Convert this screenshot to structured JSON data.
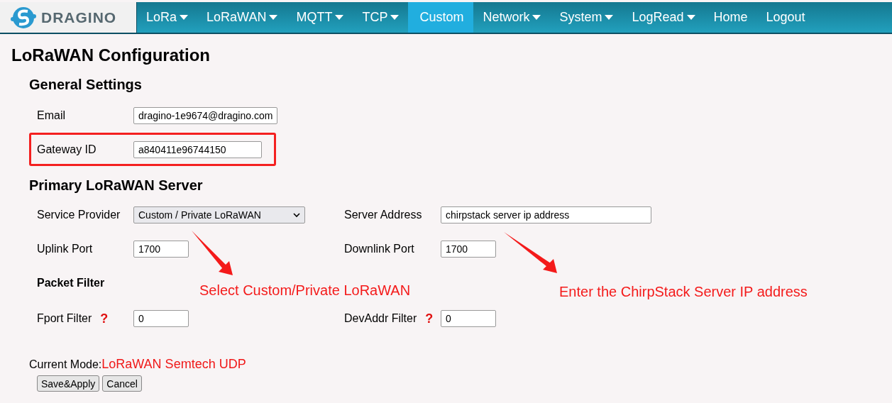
{
  "navbar": {
    "logo_text": "DRAGINO",
    "items": [
      {
        "label": "LoRa",
        "dropdown": true,
        "selected": false
      },
      {
        "label": "LoRaWAN",
        "dropdown": true,
        "selected": false
      },
      {
        "label": "MQTT",
        "dropdown": true,
        "selected": false
      },
      {
        "label": "TCP",
        "dropdown": true,
        "selected": false
      },
      {
        "label": "Custom",
        "dropdown": false,
        "selected": true
      },
      {
        "label": "Network",
        "dropdown": true,
        "selected": false
      },
      {
        "label": "System",
        "dropdown": true,
        "selected": false
      },
      {
        "label": "LogRead",
        "dropdown": true,
        "selected": false
      },
      {
        "label": "Home",
        "dropdown": false,
        "selected": false
      },
      {
        "label": "Logout",
        "dropdown": false,
        "selected": false
      }
    ]
  },
  "title": "LoRaWAN Configuration",
  "general_settings": {
    "heading": "General Settings",
    "fields": [
      {
        "label": "Email",
        "value": "dragino-1e9674@dragino.com",
        "highlighted": false
      },
      {
        "label": "Gateway ID",
        "value": "a840411e96744150",
        "highlighted": true
      }
    ]
  },
  "primary_server": {
    "heading": "Primary LoRaWAN Server",
    "rows": [
      [
        {
          "label": "Service Provider",
          "kind": "select",
          "value": "Custom / Private LoRaWAN"
        },
        {
          "label": "Server Address",
          "kind": "text",
          "value": "chirpstack server ip address"
        }
      ],
      [
        {
          "label": "Uplink Port",
          "kind": "port",
          "value": "1700"
        },
        {
          "label": "Downlink Port",
          "kind": "port",
          "value": "1700"
        }
      ]
    ]
  },
  "packet_filter": {
    "heading": "Packet Filter",
    "fields": [
      {
        "label": "Fport Filter",
        "help": "?",
        "value": "0"
      },
      {
        "label": "DevAddr Filter",
        "help": "?",
        "value": "0"
      }
    ]
  },
  "current_mode": {
    "label": "Current Mode:",
    "value": "LoRaWAN Semtech UDP"
  },
  "buttons": [
    "Save&Apply",
    "Cancel"
  ],
  "annotations": [
    "Select Custom/Private LoRaWAN",
    "Enter the ChirpStack Server IP address"
  ]
}
